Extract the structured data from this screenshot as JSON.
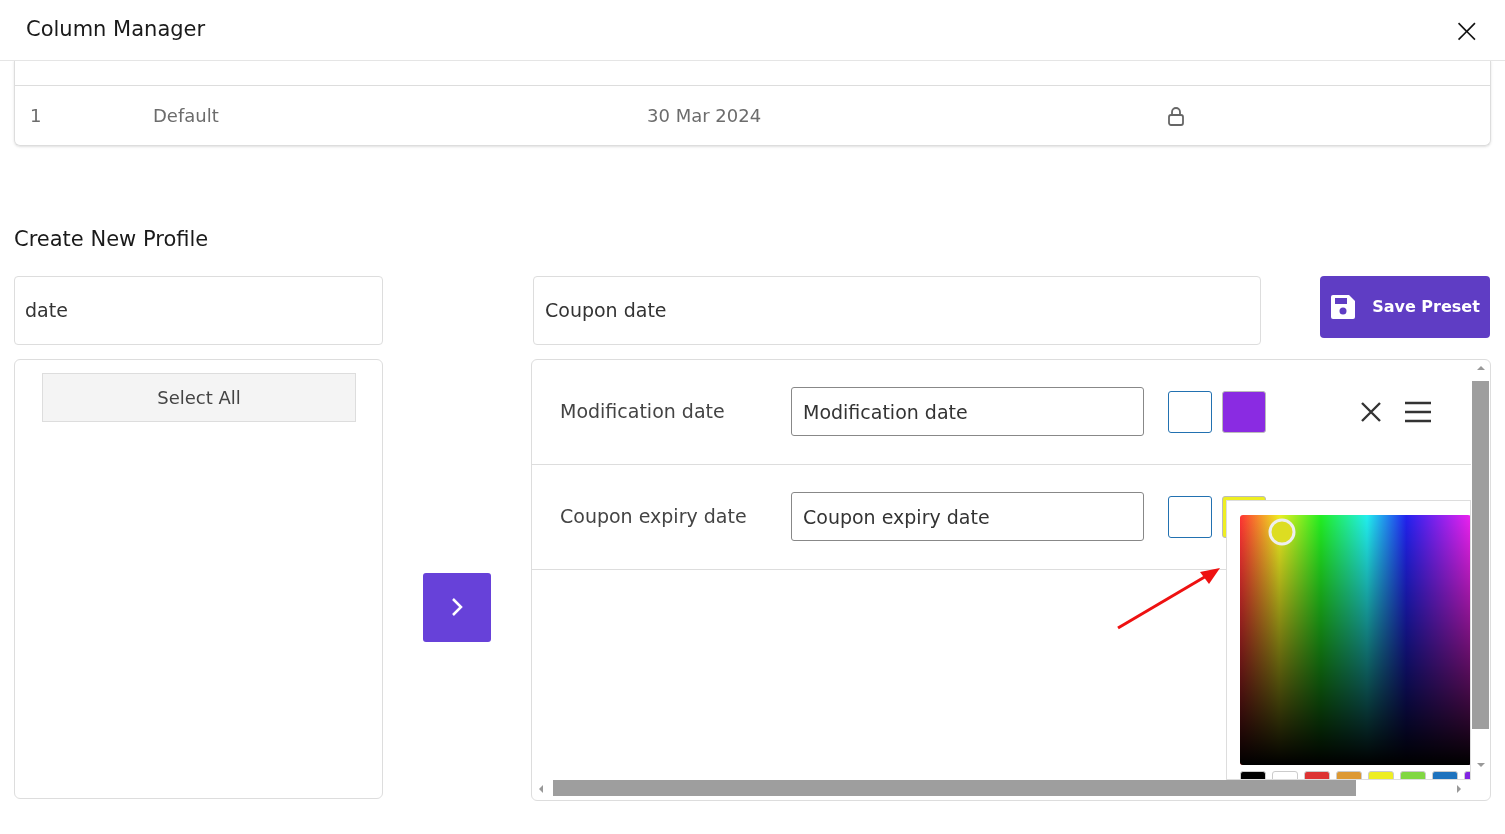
{
  "modal": {
    "title": "Column Manager",
    "close": "×"
  },
  "profiles_table": {
    "rows": [
      {
        "number": "1",
        "name": "Default",
        "date": "30 Mar 2024",
        "locked": true
      }
    ]
  },
  "create_section": {
    "title": "Create New Profile"
  },
  "search": {
    "value": "date"
  },
  "available": {
    "select_all": "Select All"
  },
  "profile_name": {
    "value": "Coupon date"
  },
  "save_button": {
    "label": "Save Preset"
  },
  "columns": [
    {
      "label": "Modification date",
      "value": "Modification date",
      "swatches": [
        {
          "color": "#ffffff"
        },
        {
          "color": "#8a2be2"
        }
      ],
      "show_actions": true
    },
    {
      "label": "Coupon expiry date",
      "value": "Coupon expiry date",
      "swatches": [
        {
          "color": "#ffffff"
        },
        {
          "color": "#eeee22"
        }
      ],
      "show_actions": false
    }
  ],
  "color_picker": {
    "open": true,
    "palette": [
      {
        "color": "#000000"
      },
      {
        "color": "#ffffff"
      },
      {
        "color": "#dd3333"
      },
      {
        "color": "#dd9933"
      },
      {
        "color": "#eeee22"
      },
      {
        "color": "#81d742"
      },
      {
        "color": "#1e73be"
      },
      {
        "color": "#8224e3"
      }
    ]
  }
}
